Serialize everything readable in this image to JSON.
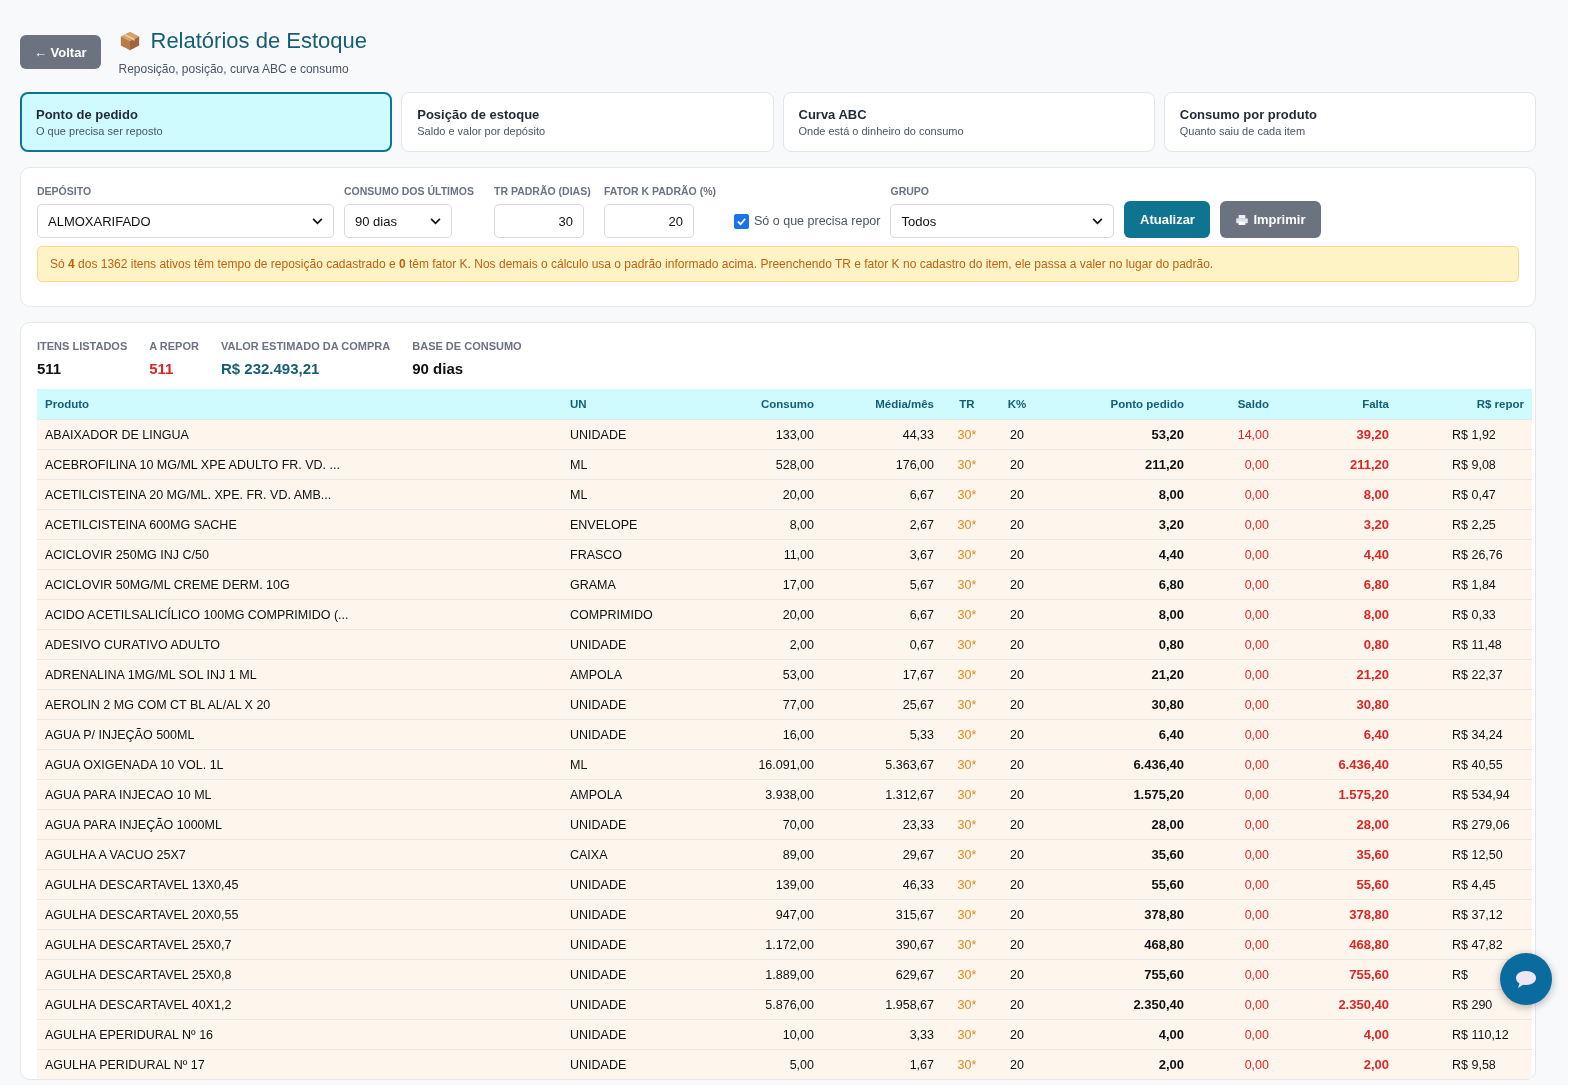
{
  "header": {
    "back_button": "← Voltar",
    "title": "Relatórios de Estoque",
    "subtitle": "Reposição, posição, curva ABC e consumo"
  },
  "tabs": [
    {
      "label": "Ponto de pedido",
      "description": "O que precisa ser reposto",
      "selected": true
    },
    {
      "label": "Posição de estoque",
      "description": "Saldo e valor por depósito",
      "selected": false
    },
    {
      "label": "Curva ABC",
      "description": "Onde está o dinheiro do consumo",
      "selected": false
    },
    {
      "label": "Consumo por produto",
      "description": "Quanto saiu de cada item",
      "selected": false
    }
  ],
  "filters": {
    "deposito": {
      "label": "DEPÓSITO",
      "value": "ALMOXARIFADO"
    },
    "consumo": {
      "label": "CONSUMO DOS ÚLTIMOS",
      "value": "90 dias"
    },
    "tr": {
      "label": "TR PADRÃO (DIAS)",
      "value": "30"
    },
    "fator_k": {
      "label": "FATOR K PADRÃO (%)",
      "value": "20"
    },
    "only_repor": {
      "label": "Só o que precisa repor",
      "checked": true
    },
    "grupo": {
      "label": "GRUPO",
      "value": "Todos"
    },
    "buttons": {
      "update": "Atualizar",
      "print": "Imprimir"
    }
  },
  "notice": "Só **4** dos 1362 itens ativos têm tempo de reposição cadastrado e **0** têm fator K. Nos demais o cálculo usa o padrão informado acima. Preenchendo TR e fator K no cadastro do item, ele passa a valer no lugar do padrão.",
  "summary": [
    {
      "label": "ITENS LISTADOS",
      "value": "511",
      "kind": "plain"
    },
    {
      "label": "A REPOR",
      "value": "511",
      "kind": "alert"
    },
    {
      "label": "VALOR ESTIMADO DA COMPRA",
      "value": "R$ 232.493,21",
      "kind": "money"
    },
    {
      "label": "BASE DE CONSUMO",
      "value": "90 dias",
      "kind": "plain"
    }
  ],
  "table": {
    "columns": [
      "Produto",
      "UN",
      "Consumo",
      "Média/mês",
      "TR",
      "K%",
      "Ponto pedido",
      "Saldo",
      "Falta",
      "R$ repor"
    ],
    "rows": [
      [
        "ABAIXADOR DE LINGUA",
        "UNIDADE",
        "133,00",
        "44,33",
        "30*",
        "20",
        "53,20",
        "14,00",
        "39,20",
        "R$ 1,92"
      ],
      [
        "ACEBROFILINA 10 MG/ML XPE ADULTO FR. VD. ...",
        "ML",
        "528,00",
        "176,00",
        "30*",
        "20",
        "211,20",
        "0,00",
        "211,20",
        "R$ 9,08"
      ],
      [
        "ACETILCISTEINA 20 MG/ML. XPE. FR. VD. AMB...",
        "ML",
        "20,00",
        "6,67",
        "30*",
        "20",
        "8,00",
        "0,00",
        "8,00",
        "R$ 0,47"
      ],
      [
        "ACETILCISTEINA 600MG SACHE",
        "ENVELOPE",
        "8,00",
        "2,67",
        "30*",
        "20",
        "3,20",
        "0,00",
        "3,20",
        "R$ 2,25"
      ],
      [
        "ACICLOVIR 250MG INJ C/50",
        "FRASCO",
        "11,00",
        "3,67",
        "30*",
        "20",
        "4,40",
        "0,00",
        "4,40",
        "R$ 26,76"
      ],
      [
        "ACICLOVIR 50MG/ML CREME DERM. 10G",
        "GRAMA",
        "17,00",
        "5,67",
        "30*",
        "20",
        "6,80",
        "0,00",
        "6,80",
        "R$ 1,84"
      ],
      [
        "ACIDO ACETILSALICÍLICO 100MG COMPRIMIDO (...",
        "COMPRIMIDO",
        "20,00",
        "6,67",
        "30*",
        "20",
        "8,00",
        "0,00",
        "8,00",
        "R$ 0,33"
      ],
      [
        "ADESIVO CURATIVO ADULTO",
        "UNIDADE",
        "2,00",
        "0,67",
        "30*",
        "20",
        "0,80",
        "0,00",
        "0,80",
        "R$ 11,48"
      ],
      [
        "ADRENALINA 1MG/ML SOL INJ 1 ML",
        "AMPOLA",
        "53,00",
        "17,67",
        "30*",
        "20",
        "21,20",
        "0,00",
        "21,20",
        "R$ 22,37"
      ],
      [
        "AEROLIN 2 MG COM CT BL AL/AL X 20",
        "UNIDADE",
        "77,00",
        "25,67",
        "30*",
        "20",
        "30,80",
        "0,00",
        "30,80"
      ],
      [
        "AGUA P/ INJEÇÃO 500ML",
        "UNIDADE",
        "16,00",
        "5,33",
        "30*",
        "20",
        "6,40",
        "0,00",
        "6,40",
        "R$ 34,24"
      ],
      [
        "AGUA OXIGENADA 10 VOL. 1L",
        "ML",
        "16.091,00",
        "5.363,67",
        "30*",
        "20",
        "6.436,40",
        "0,00",
        "6.436,40",
        "R$ 40,55"
      ],
      [
        "AGUA PARA INJECAO 10 ML",
        "AMPOLA",
        "3.938,00",
        "1.312,67",
        "30*",
        "20",
        "1.575,20",
        "0,00",
        "1.575,20",
        "R$ 534,94"
      ],
      [
        "AGUA PARA INJEÇÃO 1000ML",
        "UNIDADE",
        "70,00",
        "23,33",
        "30*",
        "20",
        "28,00",
        "0,00",
        "28,00",
        "R$ 279,06"
      ],
      [
        "AGULHA A VACUO 25X7",
        "CAIXA",
        "89,00",
        "29,67",
        "30*",
        "20",
        "35,60",
        "0,00",
        "35,60",
        "R$ 12,50"
      ],
      [
        "AGULHA DESCARTAVEL 13X0,45",
        "UNIDADE",
        "139,00",
        "46,33",
        "30*",
        "20",
        "55,60",
        "0,00",
        "55,60",
        "R$ 4,45"
      ],
      [
        "AGULHA DESCARTAVEL 20X0,55",
        "UNIDADE",
        "947,00",
        "315,67",
        "30*",
        "20",
        "378,80",
        "0,00",
        "378,80",
        "R$ 37,12"
      ],
      [
        "AGULHA DESCARTAVEL 25X0,7",
        "UNIDADE",
        "1.172,00",
        "390,67",
        "30*",
        "20",
        "468,80",
        "0,00",
        "468,80",
        "R$ 47,82"
      ],
      [
        "AGULHA DESCARTAVEL 25X0,8",
        "UNIDADE",
        "1.889,00",
        "629,67",
        "30*",
        "20",
        "755,60",
        "0,00",
        "755,60",
        "R$"
      ],
      [
        "AGULHA DESCARTAVEL 40X1,2",
        "UNIDADE",
        "5.876,00",
        "1.958,67",
        "30*",
        "20",
        "2.350,40",
        "0,00",
        "2.350,40",
        "R$ 290"
      ],
      [
        "AGULHA EPERIDURAL Nº 16",
        "UNIDADE",
        "10,00",
        "3,33",
        "30*",
        "20",
        "4,00",
        "0,00",
        "4,00",
        "R$ 110,12"
      ],
      [
        "AGULHA PERIDURAL Nº 17",
        "UNIDADE",
        "5,00",
        "1,67",
        "30*",
        "20",
        "2,00",
        "0,00",
        "2,00",
        "R$ 9,58"
      ]
    ]
  }
}
